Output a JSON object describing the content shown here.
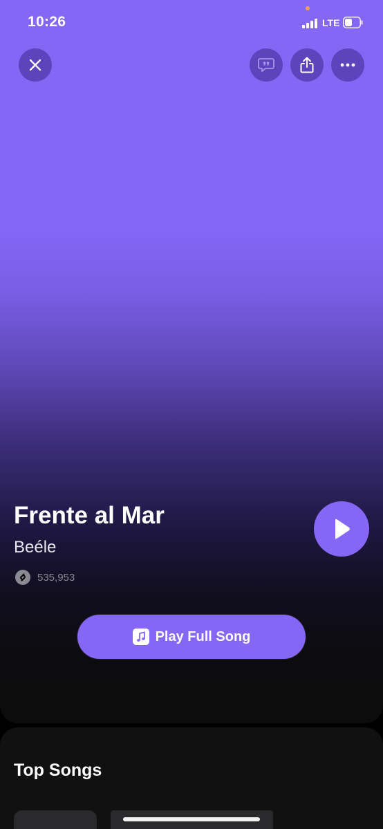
{
  "status_bar": {
    "time": "10:26",
    "network": "LTE",
    "battery_level": 0.5
  },
  "top_bar": {
    "close_icon": "close-icon",
    "lyrics_icon": "quote-bubble-icon",
    "share_icon": "share-icon",
    "more_icon": "more-icon"
  },
  "track": {
    "title": "Frente al Mar",
    "artist": "Beéle",
    "shazam_count": "535,953"
  },
  "actions": {
    "play_full_song_label": "Play Full Song"
  },
  "section": {
    "title": "Top Songs"
  },
  "colors": {
    "accent": "#8566f5",
    "background": "#000000",
    "sheet": "#111111"
  }
}
